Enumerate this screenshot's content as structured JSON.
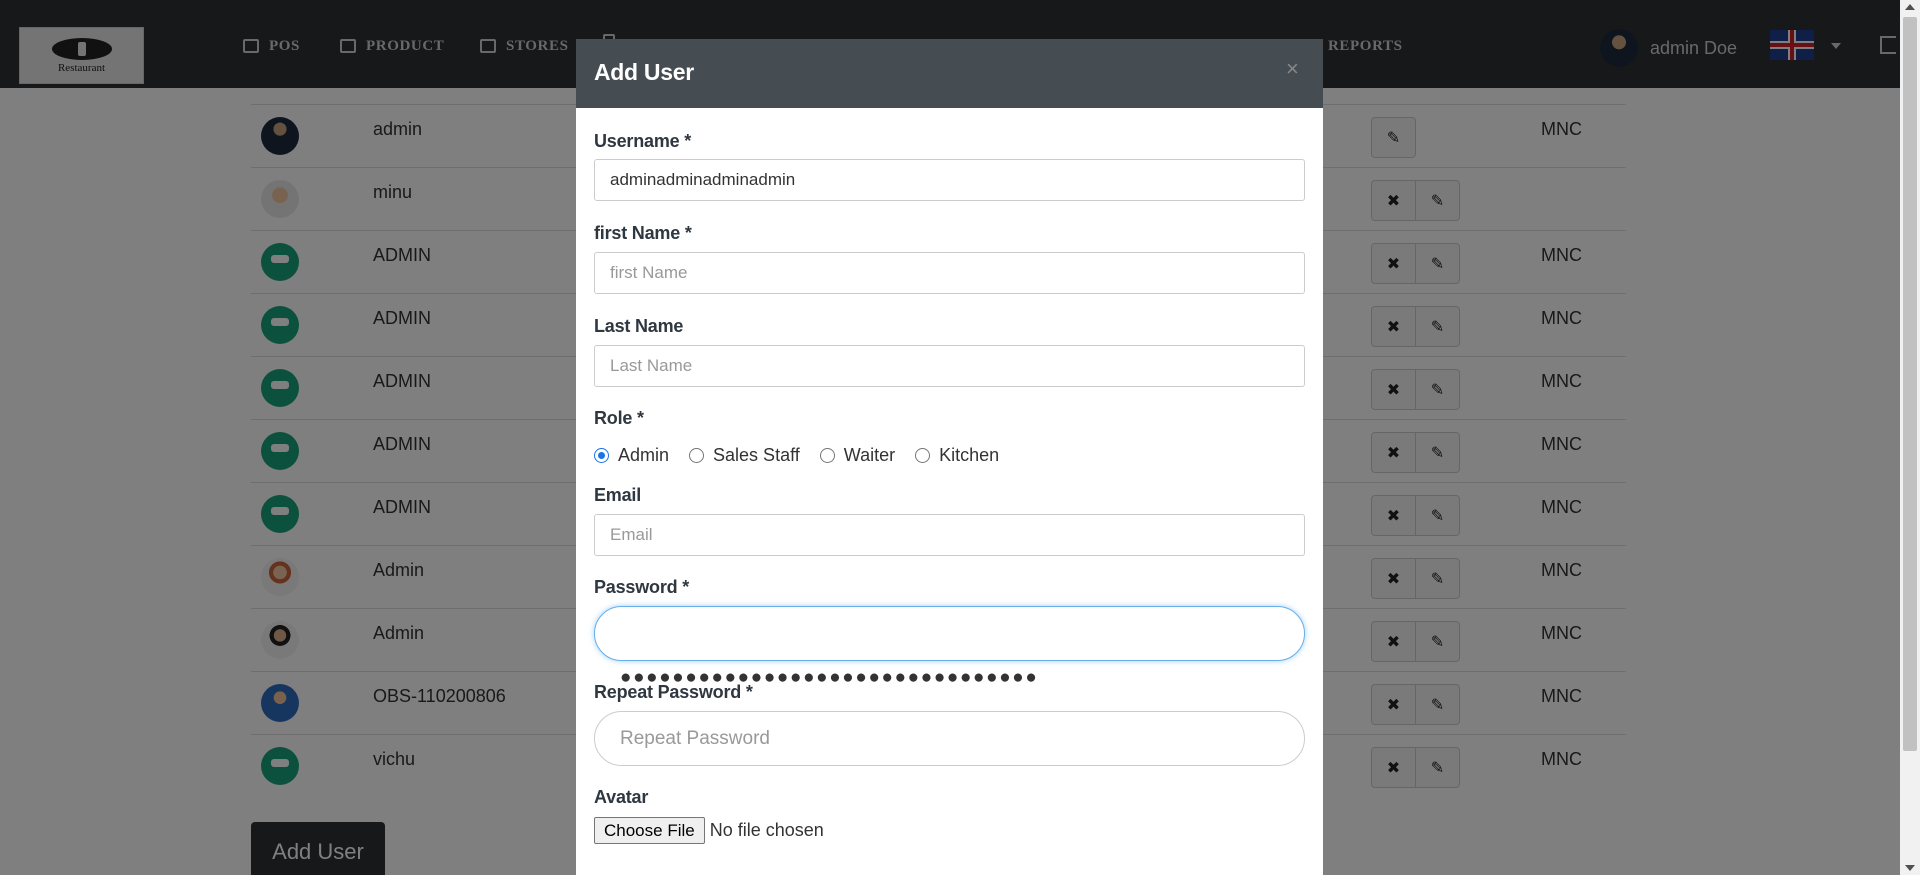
{
  "navbar": {
    "logo_text": "Restaurant",
    "items": [
      {
        "label": "POS",
        "icon": "credit-card-icon"
      },
      {
        "label": "PRODUCT",
        "icon": "tag-icon"
      },
      {
        "label": "STORES",
        "icon": "clipboard-icon"
      },
      {
        "label": "REPORTS",
        "icon": "chart-icon"
      }
    ],
    "user_name": "admin Doe",
    "language_flag": "uk-flag-icon"
  },
  "users_table": {
    "rows": [
      {
        "name": "admin",
        "company": "MNC",
        "avatar": "suit"
      },
      {
        "name": "minu",
        "company": "",
        "avatar": "girl"
      },
      {
        "name": "ADMIN",
        "company": "MNC",
        "avatar": "robot"
      },
      {
        "name": "ADMIN",
        "company": "MNC",
        "avatar": "robot"
      },
      {
        "name": "ADMIN",
        "company": "MNC",
        "avatar": "robot"
      },
      {
        "name": "ADMIN",
        "company": "MNC",
        "avatar": "robot"
      },
      {
        "name": "ADMIN",
        "company": "MNC",
        "avatar": "robot"
      },
      {
        "name": "Admin",
        "company": "MNC",
        "avatar": "lady"
      },
      {
        "name": "Admin",
        "company": "MNC",
        "avatar": "woman"
      },
      {
        "name": "OBS-110200806",
        "company": "MNC",
        "avatar": "man"
      },
      {
        "name": "vichu",
        "company": "MNC",
        "avatar": "robot"
      }
    ],
    "delete_glyph": "✖",
    "edit_glyph": "✎",
    "add_user_label": "Add User"
  },
  "modal": {
    "title": "Add User",
    "close_glyph": "×",
    "username": {
      "label": "Username *",
      "value": "adminadminadminadmin"
    },
    "first_name": {
      "label": "first Name *",
      "placeholder": "first Name"
    },
    "last_name": {
      "label": "Last Name",
      "placeholder": "Last Name"
    },
    "role": {
      "label": "Role *",
      "options": [
        "Admin",
        "Sales Staff",
        "Waiter",
        "Kitchen"
      ],
      "selected": "Admin"
    },
    "email": {
      "label": "Email",
      "placeholder": "Email"
    },
    "password": {
      "label": "Password *",
      "masked_value": "●●●●●●●●●●●●●●●●●●●●●●●●●●●●●●●●"
    },
    "repeat_password": {
      "label": "Repeat Password *",
      "placeholder": "Repeat Password"
    },
    "avatar": {
      "label": "Avatar",
      "button_label": "Choose File",
      "status": "No file chosen"
    }
  },
  "colors": {
    "navbar_bg": "#2d3134",
    "modal_header_bg": "#454c52",
    "focus_ring": "#66afe9",
    "avatar_green": "#19a37a"
  }
}
